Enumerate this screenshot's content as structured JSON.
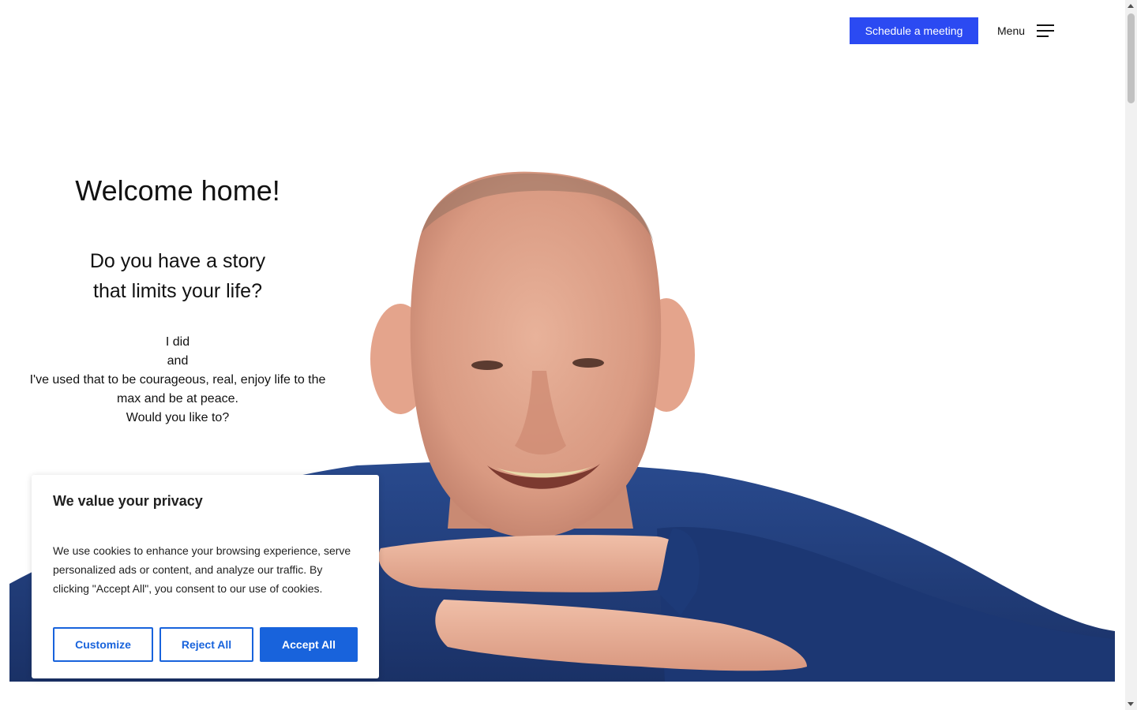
{
  "header": {
    "cta_label": "Schedule a meeting",
    "menu_label": "Menu"
  },
  "hero": {
    "title": "Welcome home!",
    "subtitle_line1": "Do you have a story",
    "subtitle_line2": "that limits your life?",
    "body_lines": [
      "I did",
      "and",
      "I've used that to be courageous, real, enjoy life to the max and be at peace.",
      "Would you like to?"
    ]
  },
  "cookie_banner": {
    "title": "We value your privacy",
    "text": "We use cookies to enhance your browsing experience, serve personalized ads or content, and analyze our traffic. By clicking \"Accept All\", you consent to our use of cookies.",
    "customize_label": "Customize",
    "reject_label": "Reject All",
    "accept_label": "Accept All"
  },
  "colors": {
    "cta_background": "#2b4af2",
    "cookie_accent": "#1863dc",
    "shirt": "#1f3c7a"
  }
}
